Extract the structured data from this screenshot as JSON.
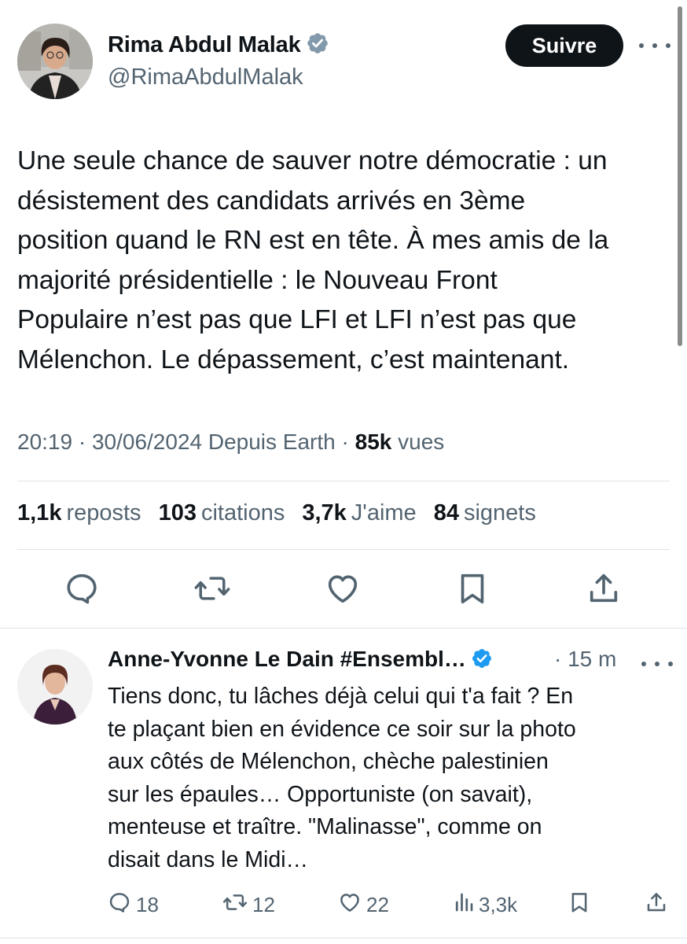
{
  "tweet": {
    "author_name": "Rima Abdul Malak",
    "author_handle": "@RimaAbdulMalak",
    "follow_label": "Suivre",
    "text_lines": [
      "Une seule chance de sauver notre démocratie : un",
      "désistement des candidats arrivés en 3ème",
      "position quand le RN est en tête. À mes amis de la",
      "majorité présidentielle : le Nouveau Front",
      "Populaire n’est pas que LFI et LFI n’est pas que",
      "Mélenchon. Le dépassement, c’est maintenant."
    ],
    "meta": {
      "time_date": "20:19 · 30/06/2024 Depuis Earth · ",
      "views_count": "85k",
      "views_label": " vues"
    },
    "stats": [
      {
        "count": "1,1k",
        "label": "reposts"
      },
      {
        "count": "103",
        "label": "citations"
      },
      {
        "count": "3,7k",
        "label": "J'aime"
      },
      {
        "count": "84",
        "label": "signets"
      }
    ],
    "actions": [
      "reply-icon",
      "repost-icon",
      "like-icon",
      "bookmark-icon",
      "share-icon"
    ]
  },
  "reply": {
    "author_name": "Anne-Yvonne Le Dain #Ensembl…",
    "time": "· 15 m",
    "text_lines": [
      "Tiens donc, tu lâches déjà celui qui t'a fait ? En",
      "te plaçant bien en évidence ce soir sur la photo",
      "aux côtés de Mélenchon, chèche palestinien",
      "sur les épaules… Opportuniste (on savait),",
      "menteuse et traître.  \"Malinasse\", comme on",
      "disait dans le Midi…"
    ],
    "actions": {
      "replies": "18",
      "reposts": "12",
      "likes": "22",
      "views": "3,3k"
    }
  },
  "colors": {
    "text": "#0f1419",
    "secondary": "#536471",
    "verified": "#829aab",
    "verified_reply": "#1d9bf0",
    "follow_bg": "#0f1419",
    "divider": "#dfe3e6"
  }
}
